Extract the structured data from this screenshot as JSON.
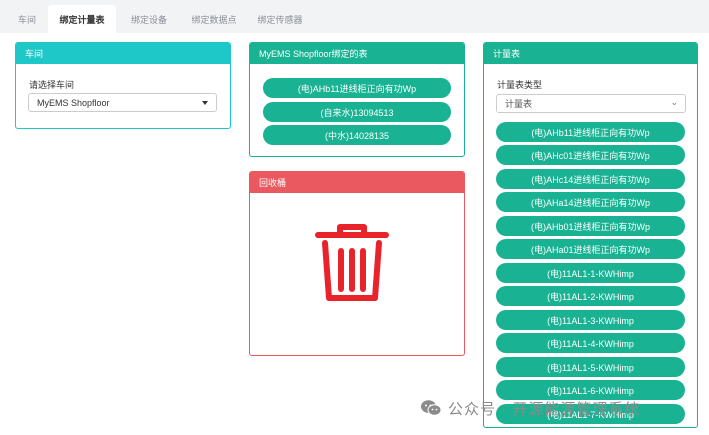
{
  "tabs": [
    {
      "label": "车间"
    },
    {
      "label": "绑定计量表"
    },
    {
      "label": "绑定设备"
    },
    {
      "label": "绑定数据点"
    },
    {
      "label": "绑定传感器"
    }
  ],
  "workshop_panel": {
    "title": "车间",
    "select_label": "请选择车间",
    "selected": "MyEMS Shopfloor"
  },
  "bound_panel": {
    "title": "MyEMS Shopfloor绑定的表",
    "meters": [
      "(电)AHb11进线柜正向有功Wp",
      "(自来水)13094513",
      "(中水)14028135"
    ]
  },
  "recycle_panel": {
    "title": "回收桶",
    "trash_icon": "trash-icon",
    "icon_color": "#e8242a"
  },
  "meter_panel": {
    "title": "计量表",
    "type_label": "计量表类型",
    "type_selected": "计量表",
    "meters": [
      "(电)AHb11进线柜正向有功Wp",
      "(电)AHc01进线柜正向有功Wp",
      "(电)AHc14进线柜正向有功Wp",
      "(电)AHa14进线柜正向有功Wp",
      "(电)AHb01进线柜正向有功Wp",
      "(电)AHa01进线柜正向有功Wp",
      "(电)11AL1-1-KWHimp",
      "(电)11AL1-2-KWHimp",
      "(电)11AL1-3-KWHimp",
      "(电)11AL1-4-KWHimp",
      "(电)11AL1-5-KWHimp",
      "(电)11AL1-6-KWHimp",
      "(电)11AL1-7-KWHimp"
    ]
  },
  "watermark": {
    "text": "公众号 · 开源能源管理系统"
  },
  "colors": {
    "teal": "#1fc8c8",
    "green": "#19b394",
    "red": "#e9595f"
  }
}
